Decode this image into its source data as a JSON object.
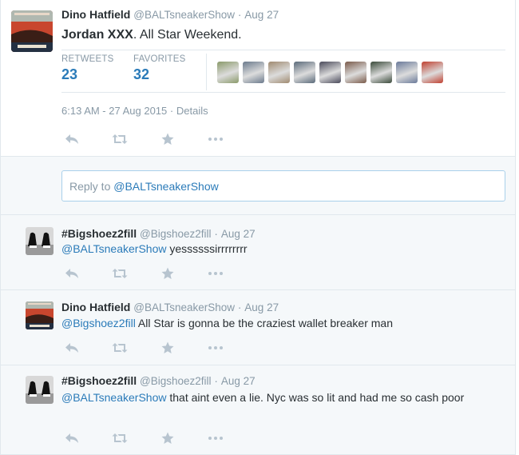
{
  "main_tweet": {
    "name": "Dino Hatfield",
    "handle": "@BALTsneakerShow",
    "separator": "·",
    "date": "Aug 27",
    "text_bold": "Jordan XXX",
    "text_rest": ". All Star Weekend.",
    "stats": {
      "retweets_label": "RETWEETS",
      "retweets_value": "23",
      "favorites_label": "FAVORITES",
      "favorites_value": "32"
    },
    "favoriter_avatar_colors": [
      "#8a9a6a",
      "#6b7a8c",
      "#a08a70",
      "#5a6a7a",
      "#4a4a5a",
      "#7a5a4a",
      "#3a4a3a",
      "#6a7a9a",
      "#c04030"
    ],
    "timestamp": "6:13 AM - 27 Aug 2015",
    "details_link": "Details"
  },
  "reply_box": {
    "prefix": "Reply to ",
    "mention": "@BALTsneakerShow"
  },
  "replies": [
    {
      "name": "#Bigshoez2fill",
      "handle": "@Bigshoez2fill",
      "date": "Aug 27",
      "mention": "@BALTsneakerShow",
      "text": " yessssssirrrrrrrr"
    },
    {
      "name": "Dino Hatfield",
      "handle": "@BALTsneakerShow",
      "date": "Aug 27",
      "mention": "@Bigshoez2fill",
      "text": " All Star is gonna be the craziest wallet breaker man"
    },
    {
      "name": "#Bigshoez2fill",
      "handle": "@Bigshoez2fill",
      "date": "Aug 27",
      "mention": "@BALTsneakerShow",
      "text": " that aint even a lie. Nyc was so lit and had me so cash poor"
    }
  ],
  "icons": [
    "reply-icon",
    "retweet-icon",
    "favorite-icon",
    "more-icon"
  ],
  "colors": {
    "link": "#2b7bb9",
    "muted": "#8899a6",
    "icon": "#b7c4cf",
    "reply_bg": "#f5f8fa"
  }
}
